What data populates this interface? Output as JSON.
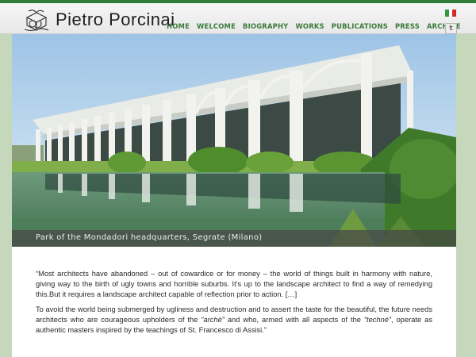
{
  "site": {
    "title": "Pietro Porcinai",
    "logo_icon": "sketch-logo-icon"
  },
  "nav": {
    "items": [
      "HOME",
      "WELCOME",
      "BIOGRAPHY",
      "WORKS",
      "PUBLICATIONS",
      "PRESS",
      "ARCHIVE"
    ]
  },
  "language": {
    "flag_icon": "italian-flag-icon"
  },
  "social": {
    "twitter_icon": "twitter-icon",
    "twitter_glyph": "t"
  },
  "hero": {
    "caption": "Park of the Mondadori headquarters, Segrate (Milano)"
  },
  "quote": {
    "p1": "“Most architects have abandoned – out of cowardice or for money – the world of things built in harmony with nature, giving way to the birth of ugly towns and horrible suburbs. It’s up to the landscape architect to find a way of remedying this.But it requires a landscape architect capable of reflection prior to action. […]",
    "p2_a": "To avoid the world being submerged by ugliness and destruction and to assert the taste for the beautiful, the future needs architects who are courageous upholders of the ",
    "p2_b": "“archè”",
    "p2_c": " and who, armed with all aspects of the ",
    "p2_d": "“techné”",
    "p2_e": ", operate as authentic masters inspired by the teachings of St. Francesco di Assisi.”"
  },
  "colors": {
    "accent_green": "#2f7f3b",
    "nav_green": "#3a7a3a",
    "side_background": "#c5d8bc"
  }
}
